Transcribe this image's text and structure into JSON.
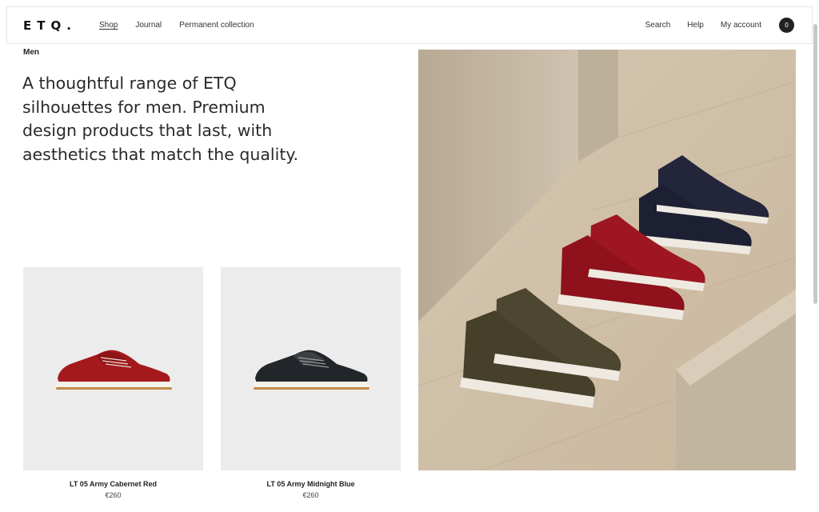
{
  "header": {
    "logo": "ETQ.",
    "nav_left": [
      "Shop",
      "Journal",
      "Permanent collection"
    ],
    "nav_right": [
      "Search",
      "Help",
      "My account"
    ],
    "cart_count": "0"
  },
  "page": {
    "category": "Men",
    "intro": "A thoughtful range of ETQ silhouettes for men. Premium design products that last, with aesthetics that match the quality."
  },
  "products": [
    {
      "name": "LT 05 Army Cabernet Red",
      "price": "€260",
      "color": "#a3191c"
    },
    {
      "name": "LT 05 Army Midnight Blue",
      "price": "€260",
      "color": "#22262a"
    }
  ],
  "colors": {
    "accent": "#222222",
    "image_bg": "#ececec",
    "stone": "#cdbfa9"
  }
}
